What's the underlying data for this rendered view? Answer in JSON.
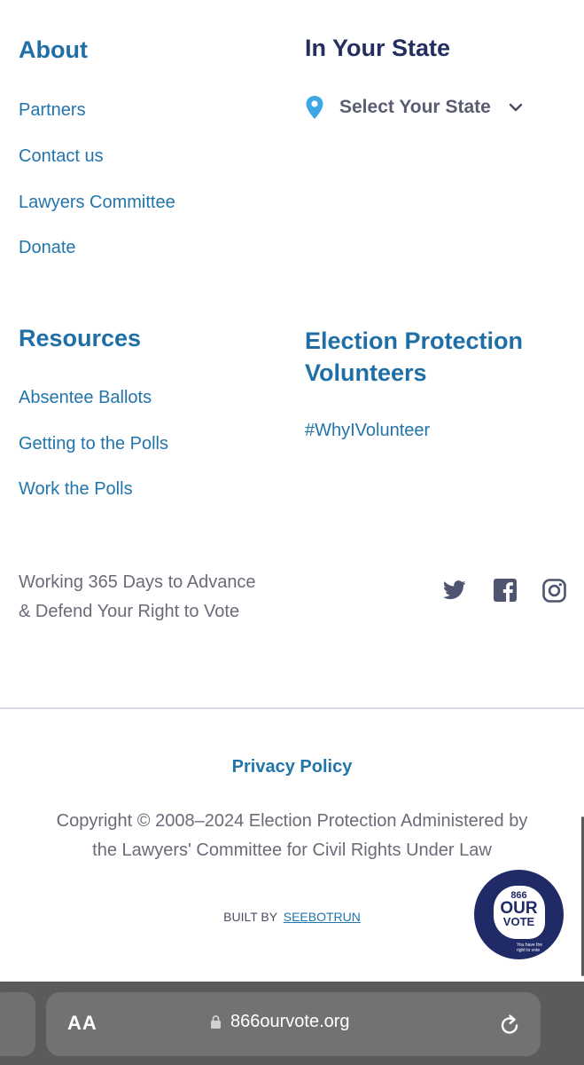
{
  "about": {
    "heading": "About",
    "links": [
      "Partners",
      "Contact us",
      "Lawyers Committee",
      "Donate"
    ]
  },
  "state": {
    "heading": "In Your State",
    "select_label": "Select Your State"
  },
  "resources": {
    "heading": "Resources",
    "links": [
      "Absentee Ballots",
      "Getting to the Polls",
      "Work the Polls"
    ]
  },
  "volunteers": {
    "heading_line1": "Election Protection",
    "heading_line2": "Volunteers",
    "link": "#WhyIVolunteer"
  },
  "tagline": {
    "line1": "Working 365 Days to Advance",
    "line2": "& Defend Your Right to Vote"
  },
  "social": [
    "twitter-icon",
    "facebook-icon",
    "instagram-icon"
  ],
  "footer": {
    "privacy": "Privacy Policy",
    "copyright_line1": "Copyright © 2008–2024 Election Protection Administered by",
    "copyright_line2": "the Lawyers' Committee for Civil Rights Under Law",
    "built_by_prefix": "BUILT BY",
    "built_by_link": "SEEBOTRUN"
  },
  "badge": {
    "line1": "866",
    "line2": "OUR",
    "line3": "VOTE",
    "line4": "You have the",
    "line5": "right to vote"
  },
  "browser": {
    "text_size_label": "AA",
    "url": "866ourvote.org"
  },
  "colors": {
    "link_blue": "#2275ab",
    "heading_navy": "#23305f",
    "badge_navy": "#1f2a66",
    "browser_bar": "#5b5b5d"
  }
}
